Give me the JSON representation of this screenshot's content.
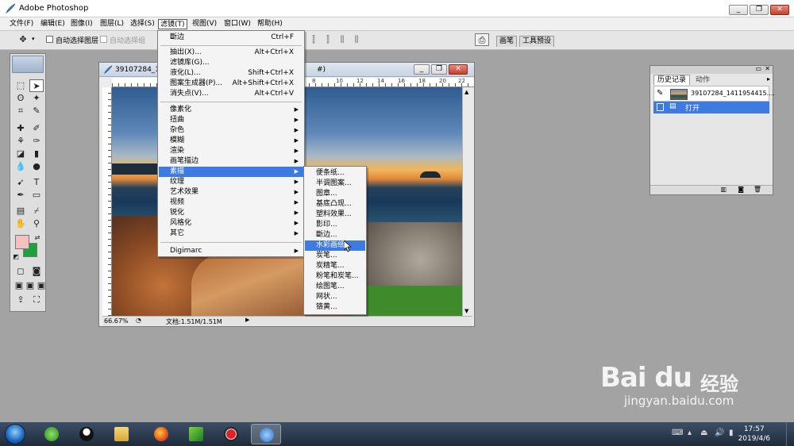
{
  "app": {
    "title": "Adobe Photoshop"
  },
  "window_controls": {
    "minimize": "_",
    "restore": "❐",
    "close": "✕"
  },
  "menubar": {
    "items": [
      {
        "label": "文件(F)"
      },
      {
        "label": "编辑(E)"
      },
      {
        "label": "图像(I)"
      },
      {
        "label": "图层(L)"
      },
      {
        "label": "选择(S)"
      },
      {
        "label": "滤镜(T)"
      },
      {
        "label": "视图(V)"
      },
      {
        "label": "窗口(W)"
      },
      {
        "label": "帮助(H)"
      }
    ]
  },
  "options_bar": {
    "auto_select_layer": "自动选择图层",
    "auto_select_group": "自动选择组",
    "palette_tabs": [
      "画笔",
      "工具预设"
    ]
  },
  "document": {
    "title": "39107284_14",
    "title_suffix": "#)",
    "zoom": "66.67%",
    "doc_info": "文档:1.51M/1.51M",
    "ruler_marks": [
      "8",
      "10",
      "12",
      "14",
      "16",
      "18",
      "20",
      "22"
    ]
  },
  "filter_menu": {
    "items": [
      {
        "label": "斷边",
        "shortcut": "Ctrl+F"
      },
      {
        "label": "抽出(X)...",
        "shortcut": "Alt+Ctrl+X"
      },
      {
        "label": "滤镜库(G)...",
        "shortcut": ""
      },
      {
        "label": "液化(L)...",
        "shortcut": "Shift+Ctrl+X"
      },
      {
        "label": "图案生成器(P)...",
        "shortcut": "Alt+Shift+Ctrl+X"
      },
      {
        "label": "消失点(V)...",
        "shortcut": "Alt+Ctrl+V"
      },
      {
        "label": "像素化",
        "submenu": true
      },
      {
        "label": "扭曲",
        "submenu": true
      },
      {
        "label": "杂色",
        "submenu": true
      },
      {
        "label": "模糊",
        "submenu": true
      },
      {
        "label": "渲染",
        "submenu": true
      },
      {
        "label": "画笔描边",
        "submenu": true
      },
      {
        "label": "素描",
        "submenu": true,
        "highlighted": true
      },
      {
        "label": "纹理",
        "submenu": true
      },
      {
        "label": "艺术效果",
        "submenu": true
      },
      {
        "label": "视频",
        "submenu": true
      },
      {
        "label": "锐化",
        "submenu": true
      },
      {
        "label": "风格化",
        "submenu": true
      },
      {
        "label": "其它",
        "submenu": true
      },
      {
        "label": "Digimarc",
        "submenu": true
      }
    ]
  },
  "sketch_submenu": {
    "items": [
      {
        "label": "便条纸..."
      },
      {
        "label": "半调图案..."
      },
      {
        "label": "图章..."
      },
      {
        "label": "基底凸现..."
      },
      {
        "label": "塑料效果..."
      },
      {
        "label": "影印..."
      },
      {
        "label": "斷边..."
      },
      {
        "label": "水彩画纸...",
        "highlighted": true
      },
      {
        "label": "炭笔..."
      },
      {
        "label": "炭精笔..."
      },
      {
        "label": "粉笔和炭笔..."
      },
      {
        "label": "绘图笔..."
      },
      {
        "label": "网状..."
      },
      {
        "label": "铬黄..."
      }
    ]
  },
  "history_panel": {
    "tabs": [
      "历史记录",
      "动作"
    ],
    "snapshot_name": "39107284_1411954415....",
    "steps": [
      "打开"
    ]
  },
  "taskbar": {
    "time": "17:57",
    "date": "2019/4/6"
  },
  "watermark": {
    "logo": "Bai du",
    "cn": "经验",
    "url": "jingyan.baidu.com"
  },
  "colors": {
    "foreground": "#f4c1c1",
    "background": "#1aa33a",
    "highlight": "#3e7be0"
  }
}
